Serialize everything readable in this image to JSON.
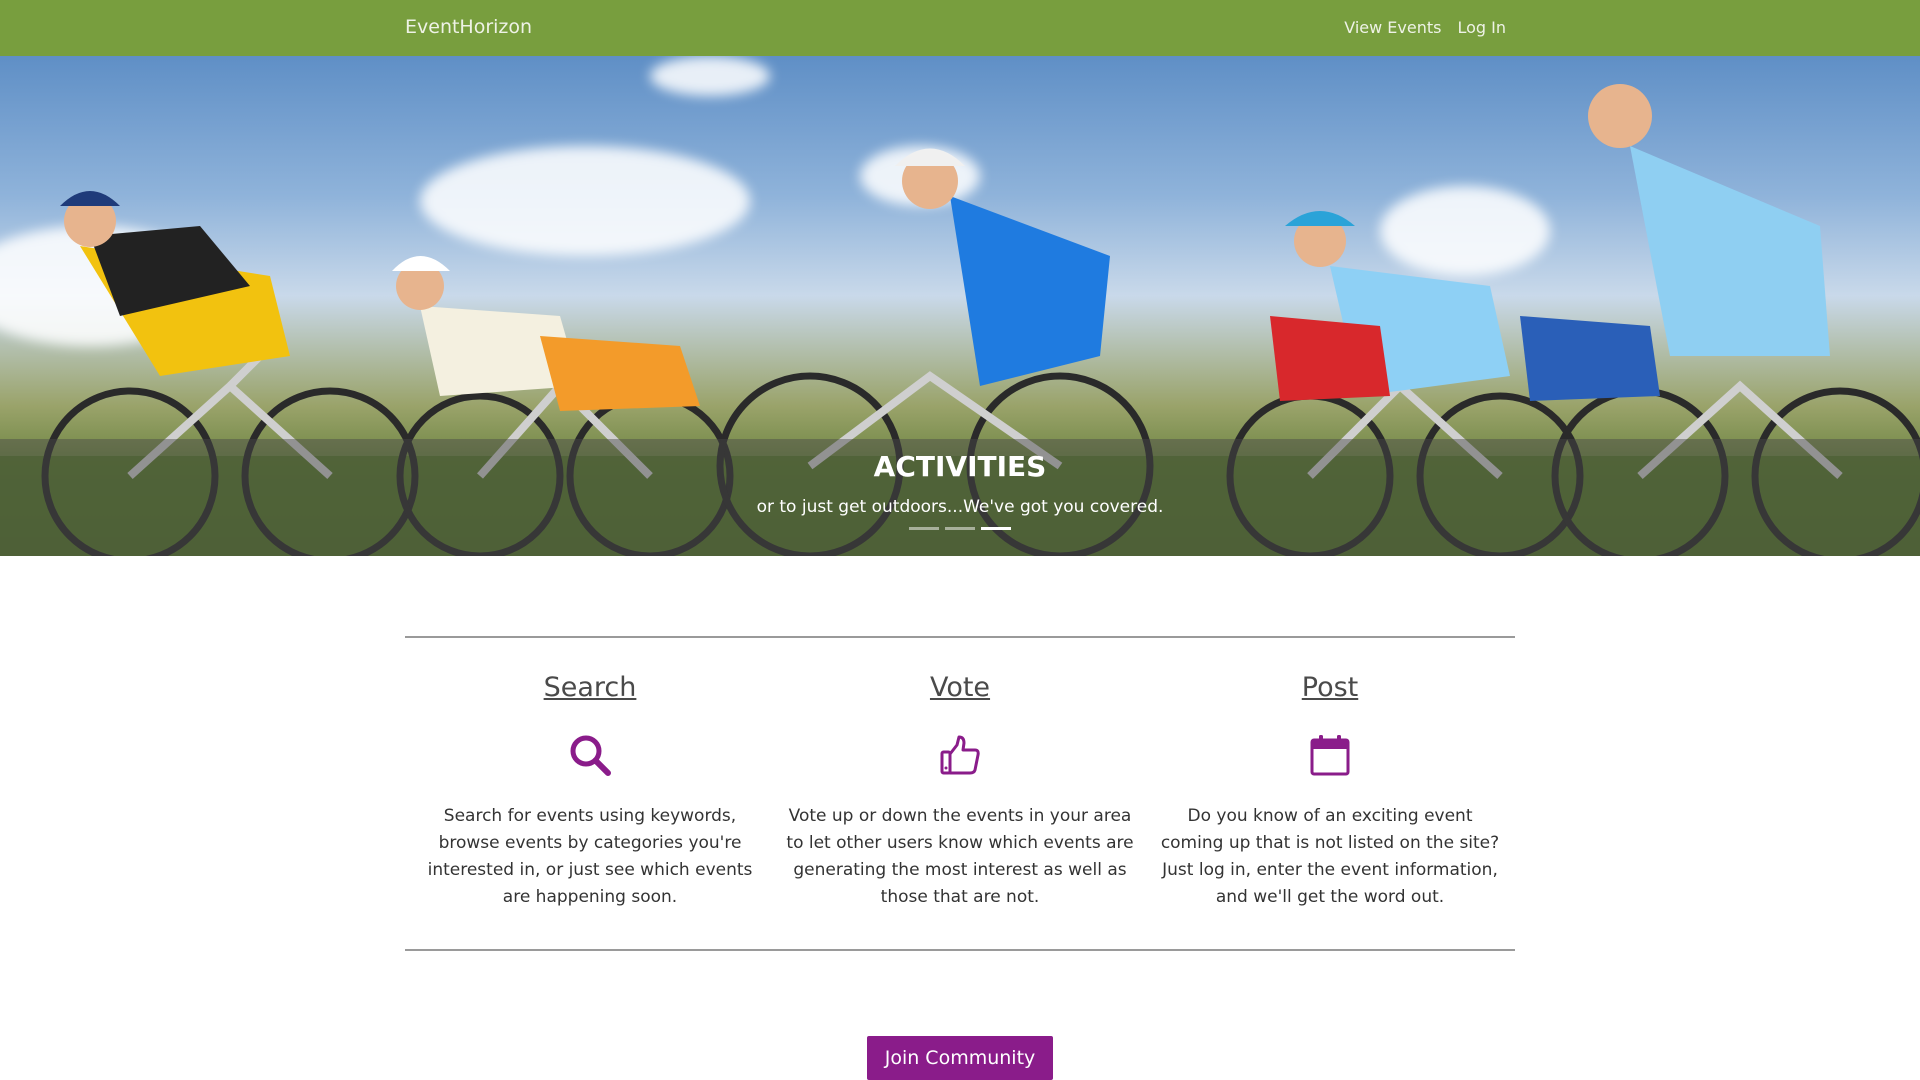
{
  "navbar": {
    "brand": "EventHorizon",
    "links": [
      "View Events",
      "Log In"
    ]
  },
  "hero": {
    "title": "ACTIVITIES",
    "subtitle": "or to just get outdoors...We've got you covered.",
    "indicator_count": 3,
    "active_indicator": 3
  },
  "features": [
    {
      "title": "Search",
      "icon": "search-icon",
      "text": "Search for events using keywords, browse events by categories you're interested in, or just see which events are happening soon."
    },
    {
      "title": "Vote",
      "icon": "thumbs-up-icon",
      "text": "Vote up or down the events in your area to let other users know which events are generating the most interest as well as those that are not."
    },
    {
      "title": "Post",
      "icon": "calendar-icon",
      "text": "Do you know of an exciting event coming up that is not listed on the site? Just log in, enter the event information, and we'll get the word out."
    }
  ],
  "cta": {
    "label": "Join Community"
  },
  "colors": {
    "navbar": "#789e3e",
    "accent": "#8a1c8a"
  }
}
